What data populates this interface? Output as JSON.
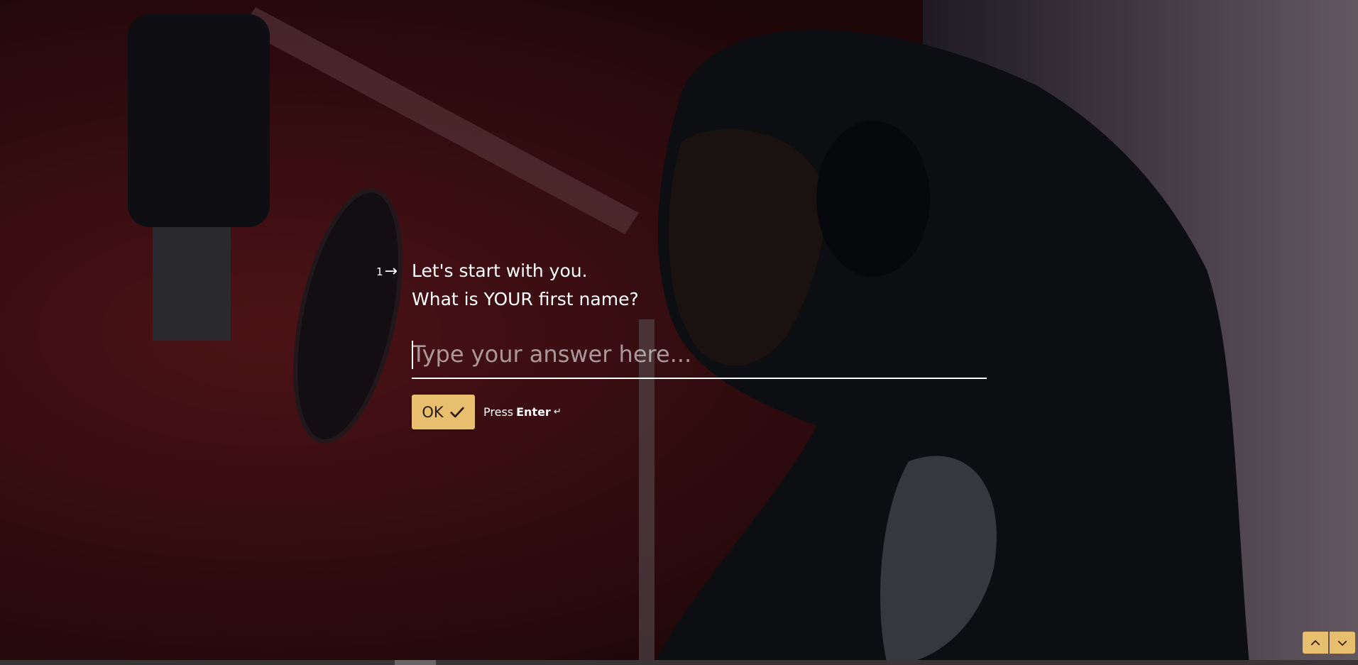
{
  "question": {
    "number": "1",
    "line1": "Let's start with you.",
    "line2": "What is YOUR first name?"
  },
  "answer": {
    "value": "",
    "placeholder": "Type your answer here..."
  },
  "ok_button": {
    "label": "OK",
    "icon": "check-icon"
  },
  "hint": {
    "press": "Press",
    "key": "Enter",
    "key_icon": "enter-return-icon"
  },
  "navigation": {
    "up_icon": "chevron-up-icon",
    "down_icon": "chevron-down-icon"
  },
  "colors": {
    "accent": "#e8bf6e",
    "text": "#ffffff"
  }
}
